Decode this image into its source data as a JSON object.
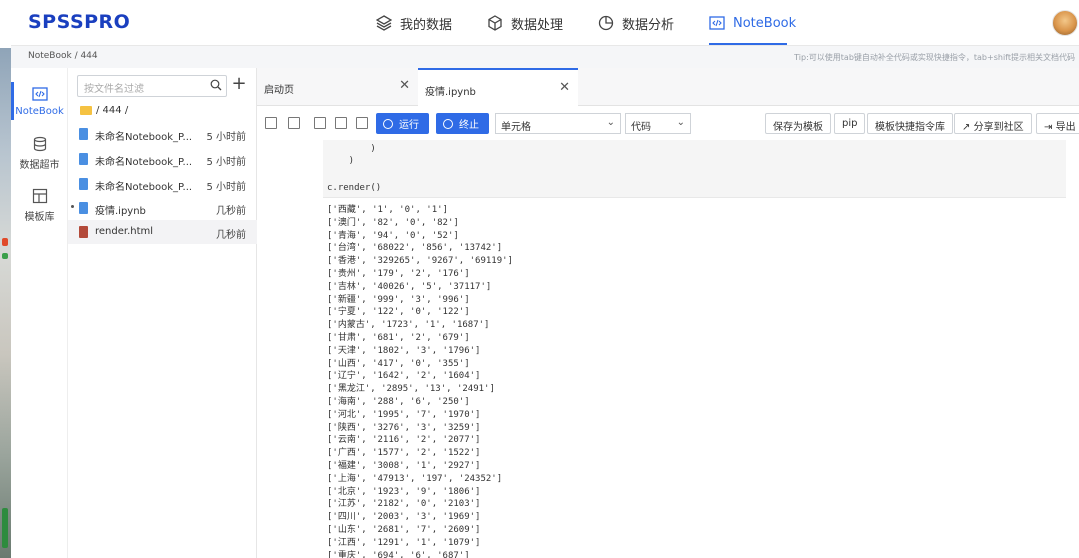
{
  "app": {
    "logo": "SPSSPRO"
  },
  "nav": [
    {
      "label": "我的数据",
      "icon": "layers-icon"
    },
    {
      "label": "数据处理",
      "icon": "cube-icon"
    },
    {
      "label": "数据分析",
      "icon": "pie-chart-icon"
    },
    {
      "label": "NoteBook",
      "icon": "code-icon",
      "active": true
    }
  ],
  "accent": "#2f6be6",
  "breadcrumb": "NoteBook / 444",
  "tip": "Tip:可以使用tab键自动补全代码或实现快捷指令，tab+shift提示相关文档代码",
  "sidebar": [
    {
      "label": "NoteBook",
      "icon": "code-icon"
    },
    {
      "label": "数据超市",
      "icon": "database-icon"
    },
    {
      "label": "模板库",
      "icon": "template-icon"
    }
  ],
  "files": {
    "search_placeholder": "按文件名过滤",
    "folder": "/ 444 /",
    "items": [
      {
        "name": "未命名Notebook_P...",
        "time": "5 小时前"
      },
      {
        "name": "未命名Notebook_P...",
        "time": "5 小时前"
      },
      {
        "name": "未命名Notebook_P...",
        "time": "5 小时前"
      },
      {
        "name": "疫情.ipynb",
        "time": "几秒前"
      },
      {
        "name": "render.html",
        "time": "几秒前"
      }
    ]
  },
  "tabs": [
    {
      "label": "启动页"
    },
    {
      "label": "疫情.ipynb"
    }
  ],
  "toolbar": {
    "run": "运行",
    "stop": "终止",
    "cell_type": "单元格",
    "code_type": "代码",
    "save_template": "保存为模板",
    "pip": "pip",
    "shortcuts": "模板快捷指令库",
    "share": "分享到社区",
    "export": "导出"
  },
  "cell": {
    "line1": "        )",
    "line2": "    )",
    "line3": "c.render()"
  },
  "output": [
    "['西藏', '1', '0', '1']",
    "['澳门', '82', '0', '82']",
    "['青海', '94', '0', '52']",
    "['台湾', '68022', '856', '13742']",
    "['香港', '329265', '9267', '69119']",
    "['贵州', '179', '2', '176']",
    "['吉林', '40026', '5', '37117']",
    "['新疆', '999', '3', '996']",
    "['宁夏', '122', '0', '122']",
    "['内蒙古', '1723', '1', '1687']",
    "['甘肃', '681', '2', '679']",
    "['天津', '1802', '3', '1796']",
    "['山西', '417', '0', '355']",
    "['辽宁', '1642', '2', '1604']",
    "['黑龙江', '2895', '13', '2491']",
    "['海南', '288', '6', '250']",
    "['河北', '1995', '7', '1970']",
    "['陕西', '3276', '3', '3259']",
    "['云南', '2116', '2', '2077']",
    "['广西', '1577', '2', '1522']",
    "['福建', '3008', '1', '2927']",
    "['上海', '47913', '197', '24352']",
    "['北京', '1923', '9', '1806']",
    "['江苏', '2182', '0', '2103']",
    "['四川', '2003', '3', '1969']",
    "['山东', '2681', '7', '2609']",
    "['江西', '1291', '1', '1079']",
    "['重庆', '694', '6', '687']"
  ]
}
